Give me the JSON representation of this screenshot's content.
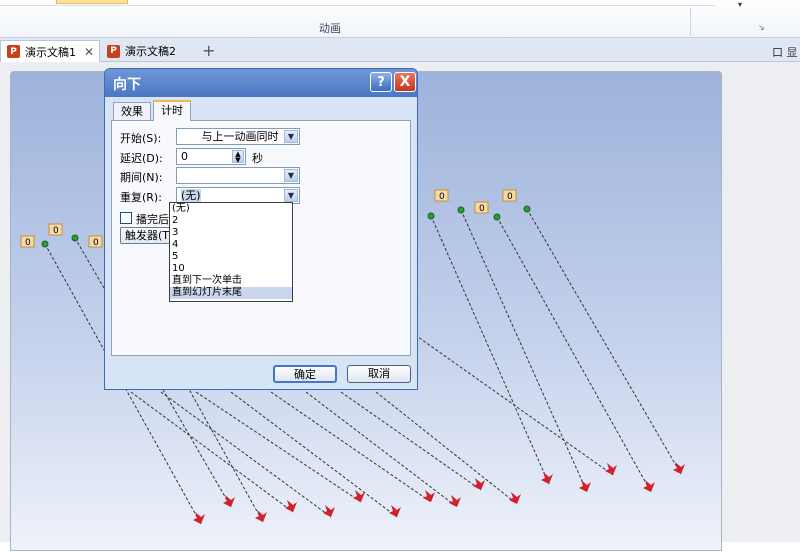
{
  "ribbon": {
    "group_label": "动画",
    "launcher_icon": "dialog-launcher-icon"
  },
  "tabs": [
    {
      "label": "演示文稿1",
      "active": true
    },
    {
      "label": "演示文稿2",
      "active": false
    }
  ],
  "tab_right_label": "口 显",
  "dialog": {
    "title": "向下",
    "help_label": "?",
    "close_label": "X",
    "tabs": [
      "效果",
      "计时"
    ],
    "start_label": "开始(S):",
    "start_value": "与上一动画同时",
    "delay_label": "延迟(D):",
    "delay_value": "0",
    "delay_unit": "秒",
    "period_label": "期间(N):",
    "period_value": "",
    "repeat_label": "重复(R):",
    "repeat_value": "(无)",
    "rewind_label": "播完后快",
    "trigger_label": "触发器(T)",
    "repeat_options": [
      "(无)",
      "2",
      "3",
      "4",
      "5",
      "10",
      "直到下一次单击",
      "直到幻灯片末尾"
    ],
    "selected_option": "直到幻灯片末尾",
    "ok_label": "确定",
    "cancel_label": "取消"
  },
  "slide": {
    "motion_badges": [
      "0",
      "0",
      "0",
      "0",
      "0",
      "0",
      "0"
    ],
    "accent_color": "#c8401e",
    "path_color": "#333333",
    "arrow_color": "#d4202a"
  }
}
